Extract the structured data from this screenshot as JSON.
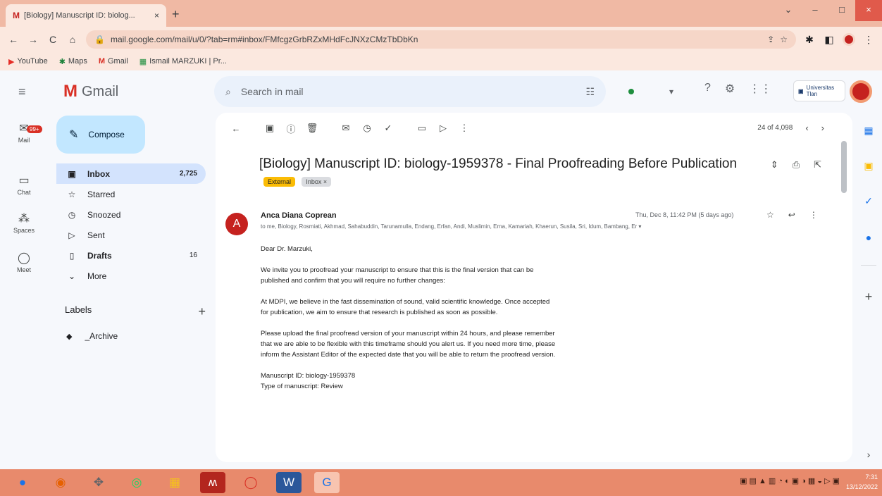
{
  "browser": {
    "tab_favicon": "M",
    "tab_title": "[Biology] Manuscript ID: biolog...",
    "tab_close": "×",
    "new_tab": "+",
    "window": {
      "minimize": "–",
      "maximize": "□",
      "close": "×",
      "dropdown": "⌄"
    },
    "back": "←",
    "forward": "→",
    "reload": "C",
    "home": "⌂",
    "lock": "🔒",
    "url": "mail.google.com/mail/u/0/?tab=rm#inbox/FMfcgzGrbRZxMHdFcJNXzCMzTbDbKn",
    "bookmarks": [
      {
        "icon": "▶",
        "label": "YouTube"
      },
      {
        "icon": "✱",
        "label": "Maps"
      },
      {
        "icon": "M",
        "label": "Gmail"
      },
      {
        "icon": "▦",
        "label": "Ismail MARZUKI | Pr..."
      }
    ]
  },
  "gmail": {
    "logo_letter": "M",
    "logo_text": "Gmail",
    "search_placeholder": "Search in mail",
    "status_caret": "▾",
    "header_icons": {
      "help": "?",
      "settings": "⚙",
      "apps": "⋮⋮"
    },
    "org_badge": "Universitas Tlan"
  },
  "rail": [
    {
      "icon": "✉",
      "label": "Mail",
      "badge": "99+"
    },
    {
      "icon": "▭",
      "label": "Chat"
    },
    {
      "icon": "⁂",
      "label": "Spaces"
    },
    {
      "icon": "◯",
      "label": "Meet"
    }
  ],
  "sidebar": {
    "compose": "Compose",
    "items": [
      {
        "icon": "▣",
        "label": "Inbox",
        "count": "2,725"
      },
      {
        "icon": "☆",
        "label": "Starred",
        "count": ""
      },
      {
        "icon": "◷",
        "label": "Snoozed",
        "count": ""
      },
      {
        "icon": "▷",
        "label": "Sent",
        "count": ""
      },
      {
        "icon": "▯",
        "label": "Drafts",
        "count": "16"
      },
      {
        "icon": "⌄",
        "label": "More",
        "count": ""
      }
    ],
    "labels_heading": "Labels",
    "labels_add": "+",
    "labels": [
      {
        "icon": "◆",
        "label": "_Archive"
      }
    ]
  },
  "toolbar": {
    "back": "←",
    "archive": "▣",
    "report": "ⓘ",
    "delete": "🗑",
    "unread": "✉",
    "snooze": "◷",
    "task": "✓",
    "move": "▭",
    "label": "▷",
    "more": "⋮",
    "pager_text": "24 of 4,098",
    "prev": "‹",
    "next": "›"
  },
  "message": {
    "subject": "[Biology] Manuscript ID: biology-1959378 - Final Proofreading Before Publication",
    "chip_external": "External",
    "chip_inbox": "Inbox ×",
    "subject_icons": {
      "expand": "⇕",
      "print": "⎙",
      "popout": "⇱"
    },
    "avatar_letter": "A",
    "sender": "Anca Diana Coprean",
    "recipients": "to me, Biology, Rosmiati, Akhmad, Sahabuddin, Tarunamulla, Endang, Erfan, Andi, Muslimin, Erna, Kamariah, Khaerun, Susila, Sri, Idum, Bambang, Er ▾",
    "date": "Thu, Dec 8, 11:42 PM (5 days ago)",
    "msg_icons": {
      "star": "☆",
      "reply": "↩",
      "more": "⋮"
    },
    "greeting": "Dear Dr. Marzuki,",
    "para1": "We invite you to proofread your manuscript to ensure that this is the final version that can be published and confirm that you will require no further changes:",
    "para2": "At MDPI, we believe in the fast dissemination of sound, valid scientific knowledge. Once accepted for publication, we aim to ensure that research is published as soon as possible.",
    "para3": "Please upload the final proofread version of your manuscript within 24 hours, and please remember that we are able to be flexible with this timeframe should you alert us. If you need more time, please inform the Assistant Editor of the expected date that you will be able to return the proofread version.",
    "manuscript_id": "Manuscript ID: biology-1959378",
    "manuscript_type": "Type of manuscript: Review"
  },
  "right_rail": {
    "add": "+",
    "expand": "›"
  },
  "taskbar": {
    "apps": [
      "●",
      "◉",
      "✥",
      "◎",
      "▦",
      "ʍ",
      "◯",
      "W",
      "G"
    ],
    "tray": "▣ ▤ ▲ ▥ ◔ ◐ ▣ ◑ ▦ ◒ ▷ ▣",
    "time": "7:31",
    "date": "13/12/2022"
  },
  "colors": {
    "gmail_red": "#d93025",
    "compose_bg": "#c2e7ff",
    "active_nav": "#d3e3fd",
    "external_chip": "#fbbc04",
    "search_bg": "#eaf1fb"
  }
}
